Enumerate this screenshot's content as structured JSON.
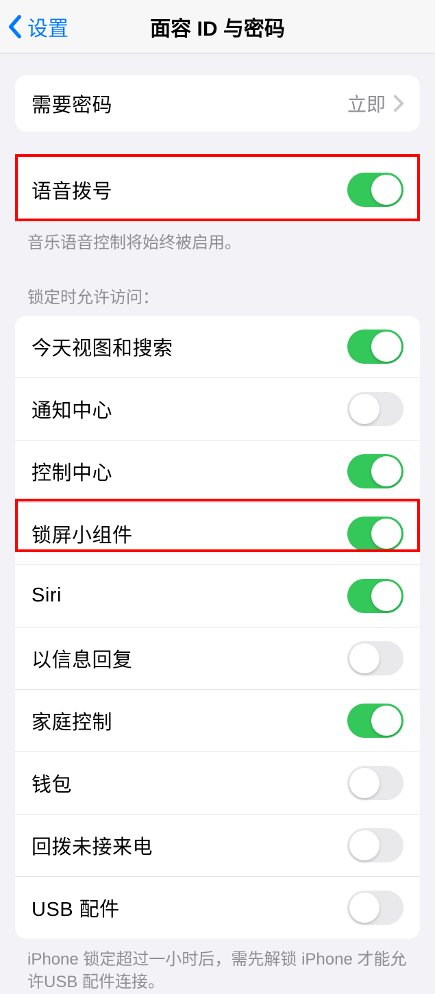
{
  "header": {
    "back_label": "设置",
    "title": "面容 ID 与密码"
  },
  "passcode_section": {
    "label": "需要密码",
    "value": "立即"
  },
  "voice_section": {
    "label": "语音拨号",
    "enabled": true,
    "footer": "音乐语音控制将始终被启用。"
  },
  "lock_section": {
    "header": "锁定时允许访问：",
    "items": [
      {
        "label": "今天视图和搜索",
        "enabled": true
      },
      {
        "label": "通知中心",
        "enabled": false
      },
      {
        "label": "控制中心",
        "enabled": true
      },
      {
        "label": "锁屏小组件",
        "enabled": true
      },
      {
        "label": "Siri",
        "enabled": true
      },
      {
        "label": "以信息回复",
        "enabled": false
      },
      {
        "label": "家庭控制",
        "enabled": true
      },
      {
        "label": "钱包",
        "enabled": false
      },
      {
        "label": "回拨未接来电",
        "enabled": false
      },
      {
        "label": "USB 配件",
        "enabled": false
      }
    ],
    "footer": "iPhone 锁定超过一小时后，需先解锁 iPhone 才能允许USB 配件连接。"
  }
}
